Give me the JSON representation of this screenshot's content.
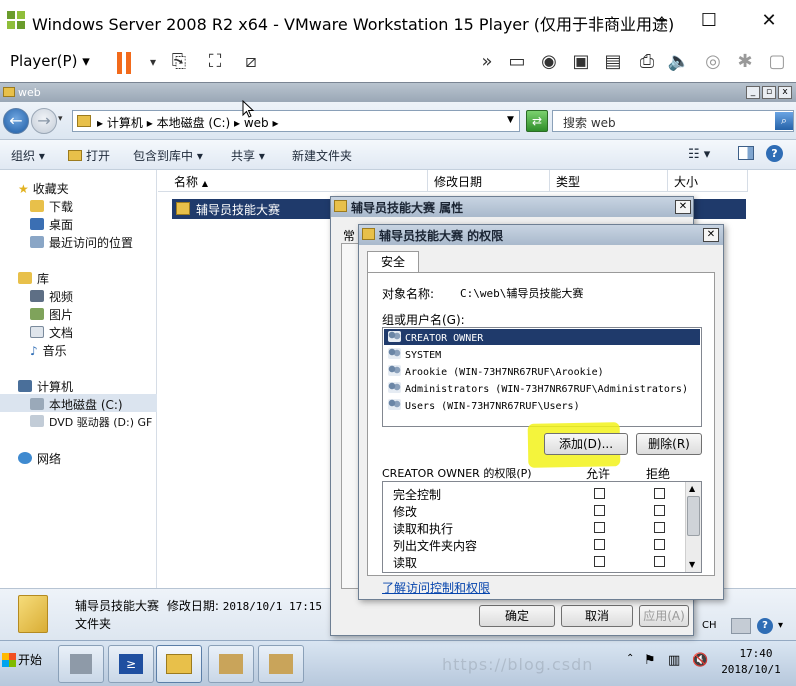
{
  "vm": {
    "title": "Windows Server 2008 R2 x64 - VMware Workstation 15 Player (仅用于非商业用途)",
    "player_menu": "Player(P)",
    "min_glyph": "─",
    "max_glyph": "☐",
    "close_glyph": "✕"
  },
  "guest_window": {
    "title": "web"
  },
  "address": {
    "crumbs": [
      "计算机",
      "本地磁盘 (C:)",
      "web"
    ],
    "search_placeholder": "搜索 web"
  },
  "commands": [
    "组织",
    "打开",
    "包含到库中",
    "共享",
    "新建文件夹"
  ],
  "nav": {
    "favorites": "收藏夹",
    "favorites_items": [
      "下载",
      "桌面",
      "最近访问的位置"
    ],
    "library": "库",
    "library_items": [
      "视频",
      "图片",
      "文档",
      "音乐"
    ],
    "computer": "计算机",
    "computer_items": [
      "本地磁盘 (C:)",
      "DVD 驱动器 (D:) GF"
    ],
    "network": "网络"
  },
  "filelist": {
    "columns": [
      "名称",
      "修改日期",
      "类型",
      "大小"
    ],
    "rows": [
      {
        "name": "辅导员技能大赛"
      }
    ]
  },
  "details": {
    "name": "辅导员技能大赛",
    "modified_label": "修改日期:",
    "modified": "2018/10/1 17:15",
    "type": "文件夹"
  },
  "taskbar": {
    "start": "开始",
    "lang": "CH",
    "time": "17:40",
    "date": "2018/10/1",
    "watermark": "https://blog.csdn"
  },
  "props_dialog": {
    "title": "辅导员技能大赛 属性",
    "tab_partial": "常",
    "ok": "确定",
    "cancel": "取消",
    "apply": "应用(A)"
  },
  "perm_dialog": {
    "title": "辅导员技能大赛 的权限",
    "tab": "安全",
    "object_label": "对象名称:",
    "object_value": "C:\\web\\辅导员技能大赛",
    "group_label": "组或用户名(G):",
    "users": [
      "CREATOR OWNER",
      "SYSTEM",
      "Arookie (WIN-73H7NR67RUF\\Arookie)",
      "Administrators (WIN-73H7NR67RUF\\Administrators)",
      "Users (WIN-73H7NR67RUF\\Users)"
    ],
    "add_btn": "添加(D)...",
    "remove_btn": "删除(R)",
    "perm_label": "CREATOR OWNER 的权限(P)",
    "allow": "允许",
    "deny": "拒绝",
    "perms": [
      "完全控制",
      "修改",
      "读取和执行",
      "列出文件夹内容",
      "读取"
    ],
    "link": "了解访问控制和权限",
    "highlight_color": "#f2f21a",
    "selection_color": "#1f3a6b"
  }
}
